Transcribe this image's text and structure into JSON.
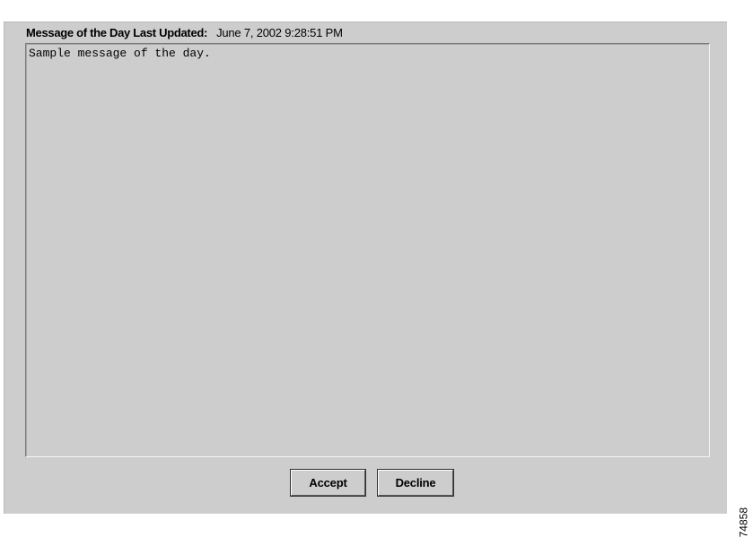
{
  "header": {
    "label": "Message of the Day Last Updated:",
    "timestamp": "June 7, 2002 9:28:51 PM"
  },
  "message": {
    "text": "Sample message of the day."
  },
  "buttons": {
    "accept_label": "Accept",
    "decline_label": "Decline"
  },
  "figure_number": "74858"
}
